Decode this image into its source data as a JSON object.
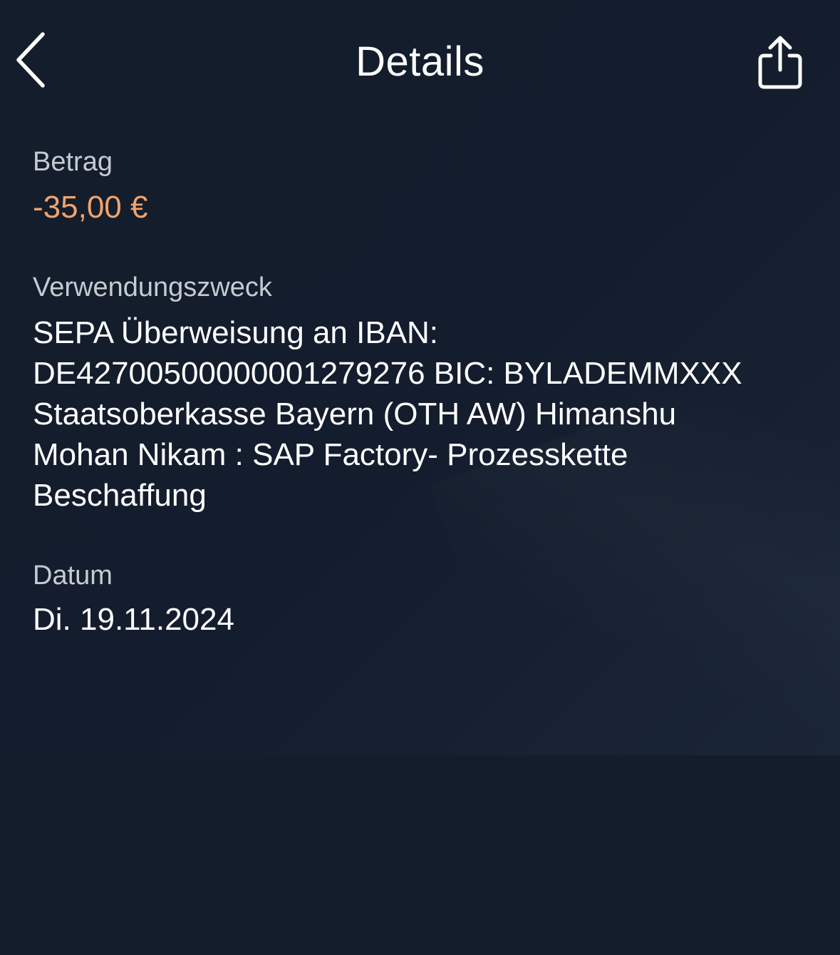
{
  "header": {
    "title": "Details",
    "back_icon": "chevron-left-icon",
    "share_icon": "share-icon"
  },
  "details": {
    "amount": {
      "label": "Betrag",
      "value": "-35,00 €",
      "color": "#f0a36c"
    },
    "purpose": {
      "label": "Verwendungszweck",
      "lines": [
        "SEPA Überweisung an IBAN:",
        "DE42700500000001279276 BIC: BYLADEMMXXX",
        "Staatsoberkasse Bayern (OTH AW) Himanshu",
        "Mohan Nikam : SAP Factory- Prozesskette",
        "Beschaffung"
      ]
    },
    "date": {
      "label": "Datum",
      "value": "Di. 19.11.2024"
    }
  },
  "colors": {
    "background": "#141d2c",
    "label_text": "#c6cbd2",
    "value_text": "#ffffff",
    "negative_amount": "#f0a36c"
  }
}
